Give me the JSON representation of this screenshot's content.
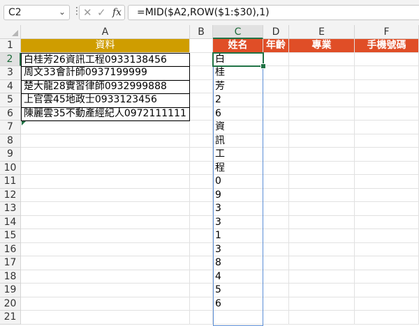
{
  "name_box": "C2",
  "name_box_dropdown_icon": "chevron-down-icon",
  "formula_bar": {
    "cancel_icon": "close-icon",
    "enter_icon": "check-icon",
    "fx_label": "fx",
    "formula": "=MID($A2,ROW($1:$30),1)"
  },
  "columns": [
    "A",
    "B",
    "C",
    "D",
    "E",
    "F"
  ],
  "rows": [
    "1",
    "2",
    "3",
    "4",
    "5",
    "6",
    "7",
    "8",
    "9",
    "10",
    "11",
    "12",
    "13",
    "14",
    "15",
    "16",
    "17",
    "18",
    "19",
    "20",
    "21"
  ],
  "headers": {
    "A1": "資料",
    "C1": "姓名",
    "D1": "年齡",
    "E1": "專業",
    "F1": "手機號碼"
  },
  "column_a_data": [
    "白桂芳26資訊工程0933138456",
    "周文33會計師0937199999",
    "楚大龍28實習律師0932999888",
    "上官雲45地政士0933123456",
    "陳麗雲35不動產經紀人0972111111"
  ],
  "column_c_values": [
    "白",
    "桂",
    "芳",
    "2",
    "6",
    "資",
    "訊",
    "工",
    "程",
    "0",
    "9",
    "3",
    "3",
    "1",
    "3",
    "8",
    "4",
    "5",
    "6"
  ],
  "colors": {
    "header_gold": "#cf9d00",
    "header_orange": "#e04e27",
    "selection_green": "#217346",
    "spill_border": "#5b8ed6"
  }
}
